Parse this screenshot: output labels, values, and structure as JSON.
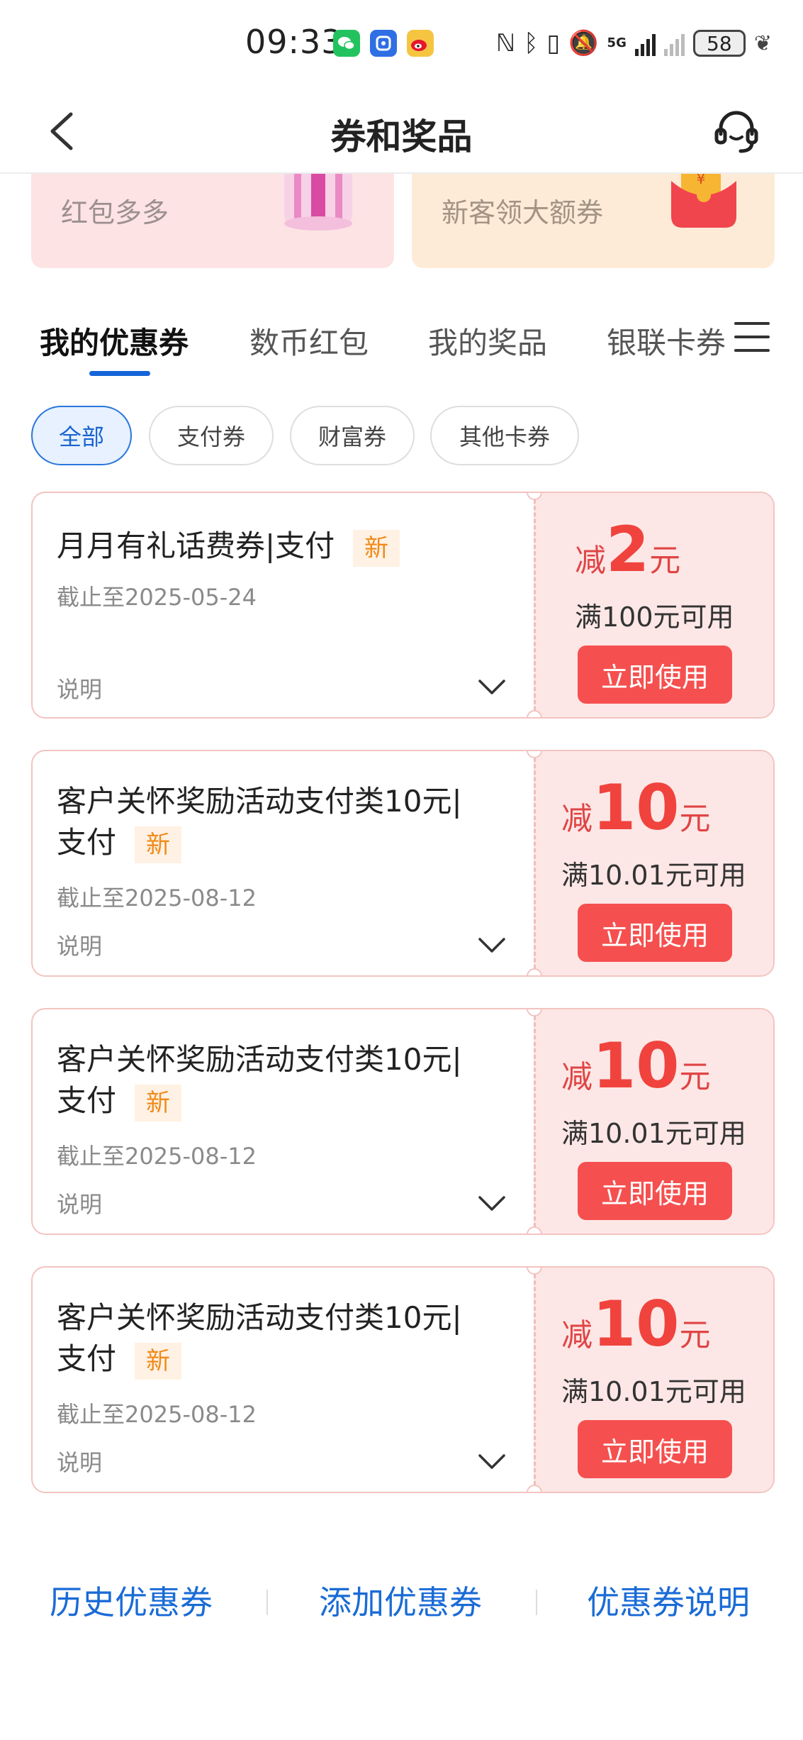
{
  "status_bar": {
    "time": "09:33",
    "network": "5G",
    "battery": "58",
    "icons": [
      "wechat-icon",
      "blue-app-icon",
      "weibo-icon",
      "nfc-icon",
      "bluetooth-icon",
      "vibrate-icon",
      "mute-icon",
      "signal-icon",
      "signal-off-icon",
      "battery-icon",
      "leaf-icon"
    ]
  },
  "header": {
    "title": "券和奖品",
    "back_icon": "chevron-left-icon",
    "service_icon": "headset-icon"
  },
  "banners": [
    {
      "text": "红包多多",
      "icon": "gift-icon",
      "color": "#fde3e4"
    },
    {
      "text": "新客领大额券",
      "icon": "red-envelope-icon",
      "color": "#fdebd7"
    }
  ],
  "tabs": [
    "我的优惠券",
    "数币红包",
    "我的奖品",
    "银联卡券"
  ],
  "filters": [
    "全部",
    "支付券",
    "财富券",
    "其他卡券"
  ],
  "coupons": [
    {
      "title": "月月有礼话费券|支付",
      "badge": "新",
      "deadline": "截止至2025-05-24",
      "explain": "说明",
      "reduce_prefix": "减",
      "amount": "2",
      "unit": "元",
      "condition": "满100元可用",
      "button": "立即使用"
    },
    {
      "title_line1": "客户关怀奖励活动支付类10元|",
      "title_line2": "支付",
      "badge": "新",
      "deadline": "截止至2025-08-12",
      "explain": "说明",
      "reduce_prefix": "减",
      "amount": "10",
      "unit": "元",
      "condition": "满10.01元可用",
      "button": "立即使用"
    },
    {
      "title_line1": "客户关怀奖励活动支付类10元|",
      "title_line2": "支付",
      "badge": "新",
      "deadline": "截止至2025-08-12",
      "explain": "说明",
      "reduce_prefix": "减",
      "amount": "10",
      "unit": "元",
      "condition": "满10.01元可用",
      "button": "立即使用"
    },
    {
      "title_line1": "客户关怀奖励活动支付类10元|",
      "title_line2": "支付",
      "badge": "新",
      "deadline": "截止至2025-08-12",
      "explain": "说明",
      "reduce_prefix": "减",
      "amount": "10",
      "unit": "元",
      "condition": "满10.01元可用",
      "button": "立即使用"
    }
  ],
  "footer": {
    "history": "历史优惠券",
    "add": "添加优惠券",
    "explain": "优惠券说明"
  },
  "colors": {
    "accent_blue": "#1565d8",
    "coupon_red": "#f0433d",
    "button_red": "#f5504f",
    "badge_orange": "#f08a1a"
  }
}
